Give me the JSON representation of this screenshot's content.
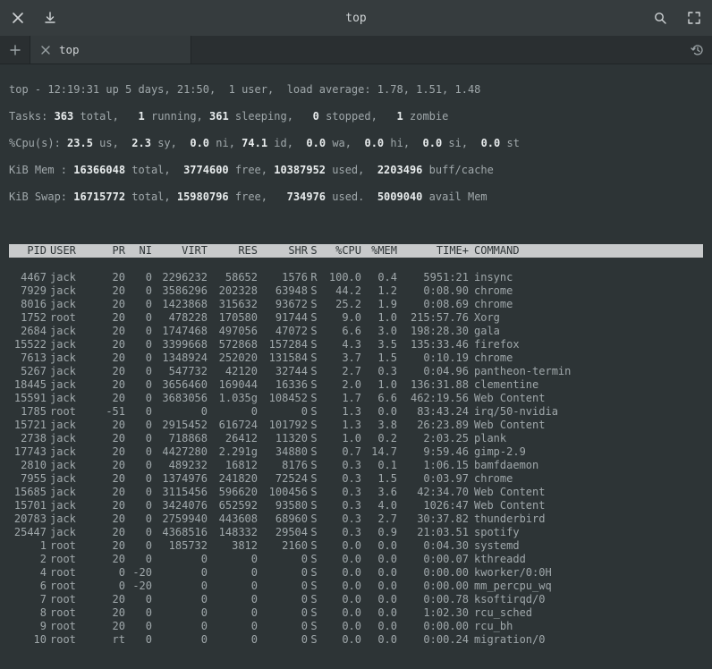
{
  "window": {
    "title": "top"
  },
  "tab": {
    "label": "top"
  },
  "summary": {
    "line1_a": "top - 12:19:31 up 5 days, 21:50,  1 user,  load average: 1.78, 1.51, 1.48",
    "tasks_total": "363",
    "tasks_running": "1",
    "tasks_sleeping": "361",
    "tasks_stopped": "0",
    "tasks_zombie": "1",
    "cpu_us": "23.5",
    "cpu_sy": "2.3",
    "cpu_ni": "0.0",
    "cpu_id": "74.1",
    "cpu_wa": "0.0",
    "cpu_hi": "0.0",
    "cpu_si": "0.0",
    "cpu_st": "0.0",
    "mem_total": "16366048",
    "mem_free": "3774600",
    "mem_used": "10387952",
    "mem_buff": "2203496",
    "swap_total": "16715772",
    "swap_free": "15980796",
    "swap_used": "734976",
    "swap_avail": "5009040"
  },
  "columns": {
    "pid": "PID",
    "user": "USER",
    "pr": "PR",
    "ni": "NI",
    "virt": "VIRT",
    "res": "RES",
    "shr": "SHR",
    "s": "S",
    "cpu": "%CPU",
    "mem": "%MEM",
    "time": "TIME+",
    "cmd": "COMMAND"
  },
  "processes": [
    {
      "pid": "4467",
      "user": "jack",
      "pr": "20",
      "ni": "0",
      "virt": "2296232",
      "res": "58652",
      "shr": "1576",
      "s": "R",
      "cpu": "100.0",
      "mem": "0.4",
      "time": "5951:21",
      "cmd": "insync"
    },
    {
      "pid": "7929",
      "user": "jack",
      "pr": "20",
      "ni": "0",
      "virt": "3586296",
      "res": "202328",
      "shr": "63948",
      "s": "S",
      "cpu": "44.2",
      "mem": "1.2",
      "time": "0:08.90",
      "cmd": "chrome"
    },
    {
      "pid": "8016",
      "user": "jack",
      "pr": "20",
      "ni": "0",
      "virt": "1423868",
      "res": "315632",
      "shr": "93672",
      "s": "S",
      "cpu": "25.2",
      "mem": "1.9",
      "time": "0:08.69",
      "cmd": "chrome"
    },
    {
      "pid": "1752",
      "user": "root",
      "pr": "20",
      "ni": "0",
      "virt": "478228",
      "res": "170580",
      "shr": "91744",
      "s": "S",
      "cpu": "9.0",
      "mem": "1.0",
      "time": "215:57.76",
      "cmd": "Xorg"
    },
    {
      "pid": "2684",
      "user": "jack",
      "pr": "20",
      "ni": "0",
      "virt": "1747468",
      "res": "497056",
      "shr": "47072",
      "s": "S",
      "cpu": "6.6",
      "mem": "3.0",
      "time": "198:28.30",
      "cmd": "gala"
    },
    {
      "pid": "15522",
      "user": "jack",
      "pr": "20",
      "ni": "0",
      "virt": "3399668",
      "res": "572868",
      "shr": "157284",
      "s": "S",
      "cpu": "4.3",
      "mem": "3.5",
      "time": "135:33.46",
      "cmd": "firefox"
    },
    {
      "pid": "7613",
      "user": "jack",
      "pr": "20",
      "ni": "0",
      "virt": "1348924",
      "res": "252020",
      "shr": "131584",
      "s": "S",
      "cpu": "3.7",
      "mem": "1.5",
      "time": "0:10.19",
      "cmd": "chrome"
    },
    {
      "pid": "5267",
      "user": "jack",
      "pr": "20",
      "ni": "0",
      "virt": "547732",
      "res": "42120",
      "shr": "32744",
      "s": "S",
      "cpu": "2.7",
      "mem": "0.3",
      "time": "0:04.96",
      "cmd": "pantheon-termin"
    },
    {
      "pid": "18445",
      "user": "jack",
      "pr": "20",
      "ni": "0",
      "virt": "3656460",
      "res": "169044",
      "shr": "16336",
      "s": "S",
      "cpu": "2.0",
      "mem": "1.0",
      "time": "136:31.88",
      "cmd": "clementine"
    },
    {
      "pid": "15591",
      "user": "jack",
      "pr": "20",
      "ni": "0",
      "virt": "3683056",
      "res": "1.035g",
      "shr": "108452",
      "s": "S",
      "cpu": "1.7",
      "mem": "6.6",
      "time": "462:19.56",
      "cmd": "Web Content"
    },
    {
      "pid": "1785",
      "user": "root",
      "pr": "-51",
      "ni": "0",
      "virt": "0",
      "res": "0",
      "shr": "0",
      "s": "S",
      "cpu": "1.3",
      "mem": "0.0",
      "time": "83:43.24",
      "cmd": "irq/50-nvidia"
    },
    {
      "pid": "15721",
      "user": "jack",
      "pr": "20",
      "ni": "0",
      "virt": "2915452",
      "res": "616724",
      "shr": "101792",
      "s": "S",
      "cpu": "1.3",
      "mem": "3.8",
      "time": "26:23.89",
      "cmd": "Web Content"
    },
    {
      "pid": "2738",
      "user": "jack",
      "pr": "20",
      "ni": "0",
      "virt": "718868",
      "res": "26412",
      "shr": "11320",
      "s": "S",
      "cpu": "1.0",
      "mem": "0.2",
      "time": "2:03.25",
      "cmd": "plank"
    },
    {
      "pid": "17743",
      "user": "jack",
      "pr": "20",
      "ni": "0",
      "virt": "4427280",
      "res": "2.291g",
      "shr": "34880",
      "s": "S",
      "cpu": "0.7",
      "mem": "14.7",
      "time": "9:59.46",
      "cmd": "gimp-2.9"
    },
    {
      "pid": "2810",
      "user": "jack",
      "pr": "20",
      "ni": "0",
      "virt": "489232",
      "res": "16812",
      "shr": "8176",
      "s": "S",
      "cpu": "0.3",
      "mem": "0.1",
      "time": "1:06.15",
      "cmd": "bamfdaemon"
    },
    {
      "pid": "7955",
      "user": "jack",
      "pr": "20",
      "ni": "0",
      "virt": "1374976",
      "res": "241820",
      "shr": "72524",
      "s": "S",
      "cpu": "0.3",
      "mem": "1.5",
      "time": "0:03.97",
      "cmd": "chrome"
    },
    {
      "pid": "15685",
      "user": "jack",
      "pr": "20",
      "ni": "0",
      "virt": "3115456",
      "res": "596620",
      "shr": "100456",
      "s": "S",
      "cpu": "0.3",
      "mem": "3.6",
      "time": "42:34.70",
      "cmd": "Web Content"
    },
    {
      "pid": "15701",
      "user": "jack",
      "pr": "20",
      "ni": "0",
      "virt": "3424076",
      "res": "652592",
      "shr": "93580",
      "s": "S",
      "cpu": "0.3",
      "mem": "4.0",
      "time": "1026:47",
      "cmd": "Web Content"
    },
    {
      "pid": "20783",
      "user": "jack",
      "pr": "20",
      "ni": "0",
      "virt": "2759940",
      "res": "443608",
      "shr": "68960",
      "s": "S",
      "cpu": "0.3",
      "mem": "2.7",
      "time": "30:37.82",
      "cmd": "thunderbird"
    },
    {
      "pid": "25447",
      "user": "jack",
      "pr": "20",
      "ni": "0",
      "virt": "4368516",
      "res": "148332",
      "shr": "29504",
      "s": "S",
      "cpu": "0.3",
      "mem": "0.9",
      "time": "21:03.51",
      "cmd": "spotify"
    },
    {
      "pid": "1",
      "user": "root",
      "pr": "20",
      "ni": "0",
      "virt": "185732",
      "res": "3812",
      "shr": "2160",
      "s": "S",
      "cpu": "0.0",
      "mem": "0.0",
      "time": "0:04.30",
      "cmd": "systemd"
    },
    {
      "pid": "2",
      "user": "root",
      "pr": "20",
      "ni": "0",
      "virt": "0",
      "res": "0",
      "shr": "0",
      "s": "S",
      "cpu": "0.0",
      "mem": "0.0",
      "time": "0:00.07",
      "cmd": "kthreadd"
    },
    {
      "pid": "4",
      "user": "root",
      "pr": "0",
      "ni": "-20",
      "virt": "0",
      "res": "0",
      "shr": "0",
      "s": "S",
      "cpu": "0.0",
      "mem": "0.0",
      "time": "0:00.00",
      "cmd": "kworker/0:0H"
    },
    {
      "pid": "6",
      "user": "root",
      "pr": "0",
      "ni": "-20",
      "virt": "0",
      "res": "0",
      "shr": "0",
      "s": "S",
      "cpu": "0.0",
      "mem": "0.0",
      "time": "0:00.00",
      "cmd": "mm_percpu_wq"
    },
    {
      "pid": "7",
      "user": "root",
      "pr": "20",
      "ni": "0",
      "virt": "0",
      "res": "0",
      "shr": "0",
      "s": "S",
      "cpu": "0.0",
      "mem": "0.0",
      "time": "0:00.78",
      "cmd": "ksoftirqd/0"
    },
    {
      "pid": "8",
      "user": "root",
      "pr": "20",
      "ni": "0",
      "virt": "0",
      "res": "0",
      "shr": "0",
      "s": "S",
      "cpu": "0.0",
      "mem": "0.0",
      "time": "1:02.30",
      "cmd": "rcu_sched"
    },
    {
      "pid": "9",
      "user": "root",
      "pr": "20",
      "ni": "0",
      "virt": "0",
      "res": "0",
      "shr": "0",
      "s": "S",
      "cpu": "0.0",
      "mem": "0.0",
      "time": "0:00.00",
      "cmd": "rcu_bh"
    },
    {
      "pid": "10",
      "user": "root",
      "pr": "rt",
      "ni": "0",
      "virt": "0",
      "res": "0",
      "shr": "0",
      "s": "S",
      "cpu": "0.0",
      "mem": "0.0",
      "time": "0:00.24",
      "cmd": "migration/0"
    }
  ]
}
